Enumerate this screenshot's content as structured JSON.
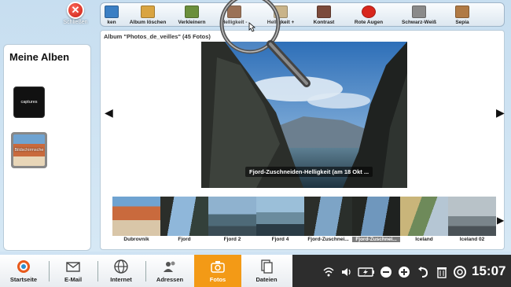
{
  "close": {
    "label": "Schließen"
  },
  "toolbar": {
    "items": [
      {
        "label": "ken",
        "color": "#3b7fc4"
      },
      {
        "label": "Album löschen",
        "color": "#d9a441"
      },
      {
        "label": "Verkleinern",
        "color": "#6b8f3c"
      },
      {
        "label": "Helligkeit -",
        "color": "#8a5a3a"
      },
      {
        "label": "Helligkeit +",
        "color": "#c9b48a"
      },
      {
        "label": "Kontrast",
        "color": "#7b4a3b"
      },
      {
        "label": "Rote Augen",
        "color": "#d8261c"
      },
      {
        "label": "Schwarz-Weiß",
        "color": "#8a8a8a"
      },
      {
        "label": "Sepia",
        "color": "#b07a45"
      }
    ]
  },
  "albums": {
    "title": "Meine Alben",
    "items": [
      {
        "label": "captures"
      },
      {
        "label": "Bildschirmsche"
      }
    ]
  },
  "main": {
    "album_info": "Album \"Photos_de_veilles\" (45 Fotos)",
    "photo_caption": "Fjord-Zuschneiden-Helligkeit (am 18 Okt ..."
  },
  "strip": {
    "items": [
      {
        "label": "Dubrovnik",
        "selected": false
      },
      {
        "label": "Fjord",
        "selected": false
      },
      {
        "label": "Fjord 2",
        "selected": false
      },
      {
        "label": "Fjord 4",
        "selected": false
      },
      {
        "label": "Fjord-Zuschnei...",
        "selected": false
      },
      {
        "label": "Fjord-Zuschnei...",
        "selected": true
      },
      {
        "label": "Iceland",
        "selected": false
      },
      {
        "label": "Iceland 02",
        "selected": false
      }
    ]
  },
  "taskbar": {
    "items": [
      {
        "label": "Startseite"
      },
      {
        "label": "E-Mail"
      },
      {
        "label": "Internet"
      },
      {
        "label": "Adressen"
      },
      {
        "label": "Fotos"
      },
      {
        "label": "Dateien"
      }
    ],
    "active": "Fotos",
    "accent": "#f39a16",
    "clock": "15:07"
  }
}
